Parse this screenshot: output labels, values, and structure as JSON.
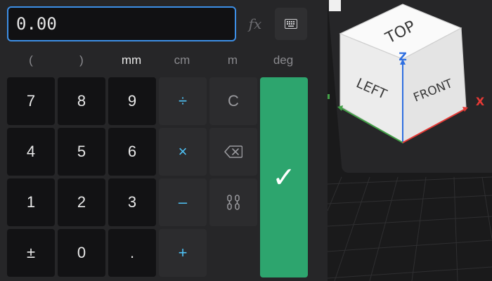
{
  "display": {
    "value": "0.00"
  },
  "toolbar": {
    "fx_label": "fx",
    "keyboard_icon": "keyboard-icon"
  },
  "units": [
    {
      "label": "("
    },
    {
      "label": ")"
    },
    {
      "label": "mm",
      "active": true
    },
    {
      "label": "cm"
    },
    {
      "label": "m"
    },
    {
      "label": "deg"
    }
  ],
  "keys": {
    "seven": "7",
    "eight": "8",
    "nine": "9",
    "divide": "÷",
    "clear": "C",
    "four": "4",
    "five": "5",
    "six": "6",
    "multiply": "×",
    "backspace_icon": "backspace-icon",
    "one": "1",
    "two": "2",
    "three": "3",
    "minus": "–",
    "link_icon": "link-icon",
    "plusminus": "±",
    "zero": "0",
    "dot": ".",
    "plus": "+",
    "confirm": "✓"
  },
  "viewcube": {
    "faces": {
      "top": "TOP",
      "left": "LEFT",
      "front": "FRONT"
    },
    "axes": {
      "x": "X",
      "z": "Z"
    },
    "colors": {
      "x_axis": "#e53935",
      "y_axis": "#43a047",
      "z_axis": "#2f6fe0"
    }
  },
  "colors": {
    "accent": "#3d8fe6",
    "confirm": "#2da56e",
    "operator": "#4fc3f7"
  }
}
